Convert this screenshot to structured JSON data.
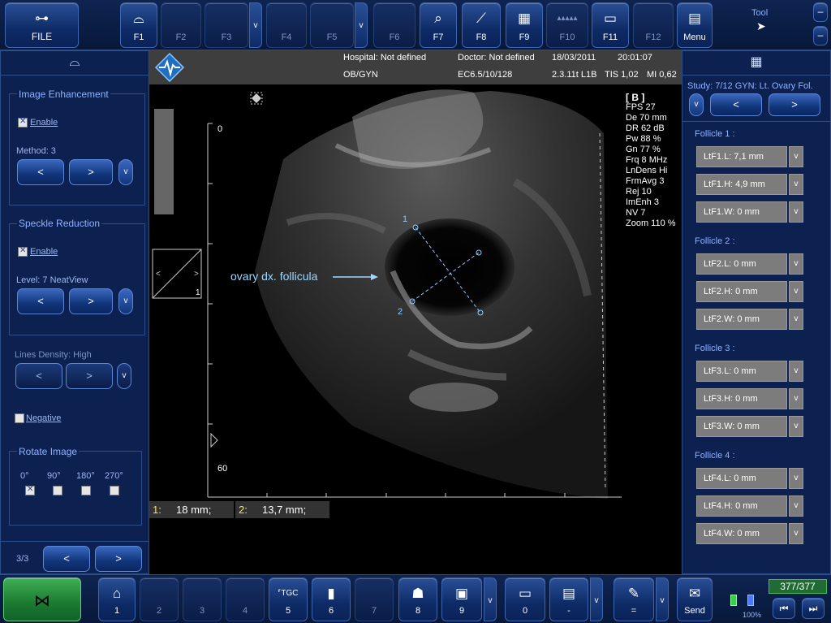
{
  "topbar": {
    "file": "FILE",
    "keys": [
      "F1",
      "F2",
      "F3",
      "F4",
      "F5",
      "F6",
      "F7",
      "F8",
      "F9",
      "F10",
      "F11",
      "F12"
    ],
    "menu": "Menu",
    "tool": "Tool"
  },
  "header": {
    "hospital": "Hospital: Not defined",
    "doctor": "Doctor: Not defined",
    "date": "18/03/2011",
    "time": "20:01:07",
    "preset": "OB/GYN",
    "probe": "EC6.5/10/128",
    "version": "2.3.11t L1B",
    "tis": "TIS 1,02",
    "mi": "MI 0,62"
  },
  "left": {
    "image_enhancement": "Image Enhancement",
    "enable": "Enable",
    "method": "Method: 3",
    "speckle_reduction": "Speckle Reduction",
    "level": "Level: 7 NeatView",
    "lines_density": "Lines Density: High",
    "negative": "Negative",
    "rotate_image": "Rotate Image",
    "rotations": [
      "0°",
      "90°",
      "180°",
      "270°"
    ],
    "page": "3/3"
  },
  "image": {
    "mode": "[ B ]",
    "params": [
      "FPS  27",
      "De  70 mm",
      "DR  62 dB",
      "Pw  88 %",
      "Gn  77 %",
      "Frq  8 MHz",
      "LnDens  Hi",
      "FrmAvg  3",
      "Rej  10",
      "ImEnh  3",
      "NV  7",
      "Zoom  110 %"
    ],
    "depth_top": "0",
    "depth_bottom": "60",
    "annotation": "ovary dx. follicula",
    "cal1": "1",
    "cal2": "2",
    "thumb_index": "1",
    "m1_label": "1:",
    "m1_value": "18 mm;",
    "m2_label": "2:",
    "m2_value": "13,7 mm;"
  },
  "right": {
    "study": "Study:  7/12 GYN: Lt. Ovary Fol.",
    "follicles": [
      {
        "title": "Follicle 1 :",
        "items": [
          "LtF1.L: 7,1  mm",
          "LtF1.H: 4,9  mm",
          "LtF1.W: 0  mm"
        ]
      },
      {
        "title": "Follicle 2 :",
        "items": [
          "LtF2.L: 0  mm",
          "LtF2.H: 0  mm",
          "LtF2.W: 0  mm"
        ]
      },
      {
        "title": "Follicle 3 :",
        "items": [
          "LtF3.L: 0  mm",
          "LtF3.H: 0  mm",
          "LtF3.W: 0  mm"
        ]
      },
      {
        "title": "Follicle 4 :",
        "items": [
          "LtF4.L: 0  mm",
          "LtF4.H: 0  mm",
          "LtF4.W: 0  mm"
        ]
      }
    ]
  },
  "bottombar": {
    "keys": [
      "1",
      "2",
      "3",
      "4",
      "5",
      "6",
      "7",
      "8",
      "9",
      "0",
      "-",
      "=",
      "Send"
    ],
    "counter": "377/377",
    "battery": "100%"
  },
  "common": {
    "prev": "<",
    "next": ">",
    "v": "v"
  }
}
